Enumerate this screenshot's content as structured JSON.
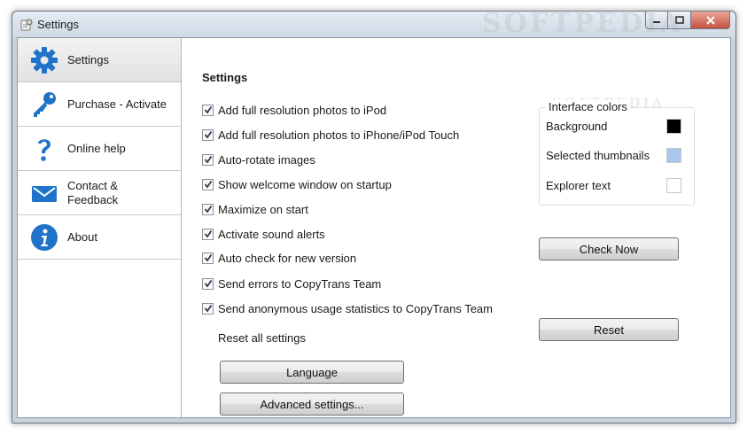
{
  "window": {
    "title": "Settings"
  },
  "watermark": "SOFTPEDIA",
  "sidebar": {
    "items": [
      {
        "label": "Settings",
        "icon": "gear-icon",
        "active": true
      },
      {
        "label": "Purchase - Activate",
        "icon": "key-icon"
      },
      {
        "label": "Online help",
        "icon": "question-mark-icon"
      },
      {
        "label": "Contact &\n Feedback",
        "icon": "envelope-icon"
      },
      {
        "label": "About",
        "icon": "info-icon"
      }
    ]
  },
  "settings": {
    "title": "Settings",
    "options": [
      {
        "label": "Add full resolution photos to iPod",
        "checked": true
      },
      {
        "label": "Add full resolution photos to iPhone/iPod Touch",
        "checked": true
      },
      {
        "label": "Auto-rotate images",
        "checked": true
      },
      {
        "label": "Show welcome window on startup",
        "checked": true
      },
      {
        "label": "Maximize on start",
        "checked": true
      },
      {
        "label": "Activate sound alerts",
        "checked": true
      },
      {
        "label": "Auto check for new version",
        "checked": true
      },
      {
        "label": "Send errors to CopyTrans Team",
        "checked": true
      },
      {
        "label": "Send anonymous usage statistics to CopyTrans Team",
        "checked": true
      }
    ],
    "reset_label": "Reset all settings",
    "check_now_button": "Check Now",
    "reset_button": "Reset",
    "language_button": "Language",
    "advanced_button": "Advanced settings..."
  },
  "interface_colors": {
    "title": "Interface colors",
    "rows": [
      {
        "label": "Background",
        "color": "#000000"
      },
      {
        "label": "Selected thumbnails",
        "color": "#a9c6ec"
      },
      {
        "label": "Explorer text",
        "color": "#ffffff"
      }
    ]
  }
}
